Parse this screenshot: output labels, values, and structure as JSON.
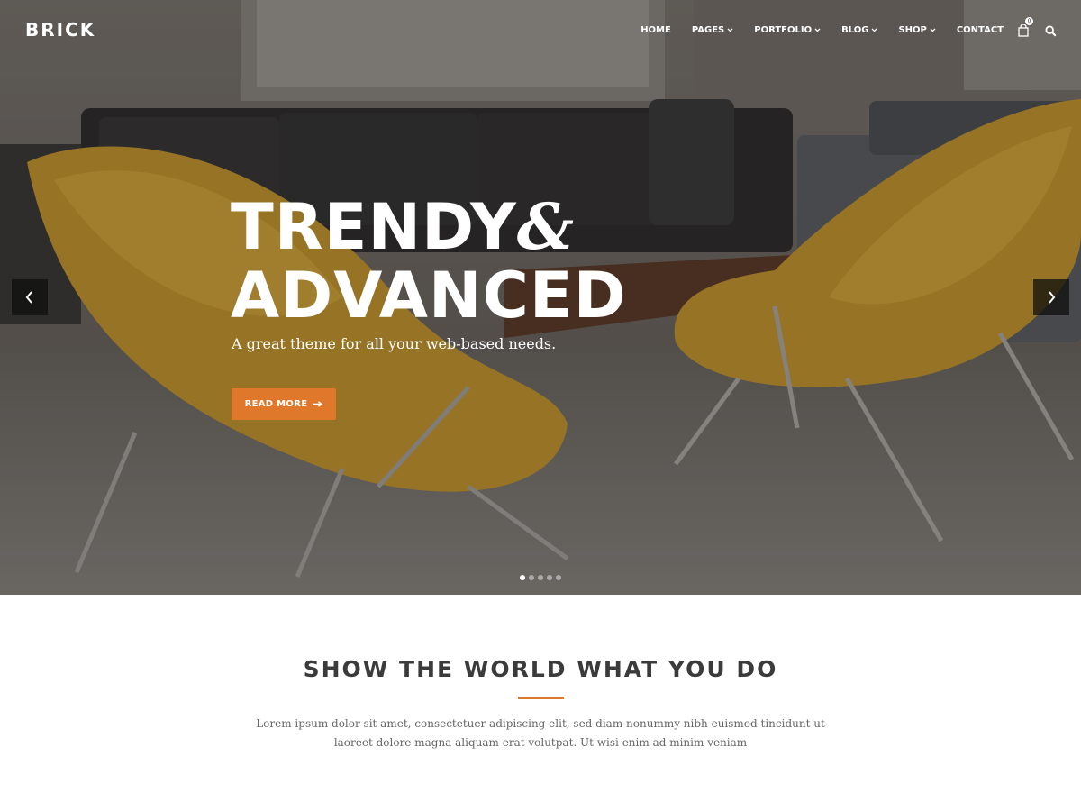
{
  "header": {
    "logo": "BRICK",
    "nav": [
      {
        "label": "HOME",
        "has_dropdown": false
      },
      {
        "label": "PAGES",
        "has_dropdown": true
      },
      {
        "label": "PORTFOLIO",
        "has_dropdown": true
      },
      {
        "label": "BLOG",
        "has_dropdown": true
      },
      {
        "label": "SHOP",
        "has_dropdown": true
      },
      {
        "label": "CONTACT",
        "has_dropdown": false
      }
    ],
    "cart_count": "0",
    "icons": [
      "cart-icon",
      "search-icon"
    ]
  },
  "hero": {
    "title_line1": "TRENDY",
    "title_amp": "&",
    "title_line2": "ADVANCED",
    "subtitle": "A great theme for all your web-based needs.",
    "button_label": "READ MORE",
    "slide_count": 5,
    "active_slide": 1
  },
  "section": {
    "title": "SHOW THE WORLD WHAT YOU DO",
    "text_line1": "Lorem ipsum dolor sit amet, consectetuer adipiscing elit, sed diam nonummy nibh euismod tincidunt ut",
    "text_line2": "laoreet dolore magna aliquam erat volutpat. Ut wisi enim ad minim veniam"
  },
  "colors": {
    "accent": "#e0782c",
    "chair": "#c99a2e",
    "text_dark": "#3b3b3b"
  }
}
